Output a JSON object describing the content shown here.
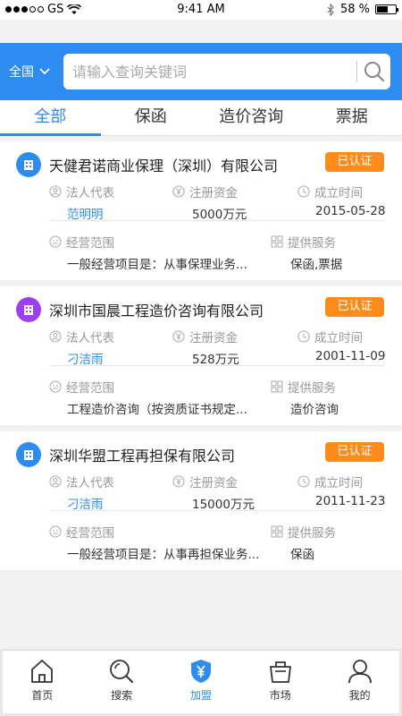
{
  "status_bar": {
    "carrier": "GS",
    "time": "9:41 AM",
    "battery": "58 %",
    "battery_level": 0.58
  },
  "header": {
    "region": "全国",
    "search_placeholder": "请输入查询关键词"
  },
  "tabs": [
    {
      "label": "全部",
      "active": true
    },
    {
      "label": "保函",
      "active": false
    },
    {
      "label": "造价咨询",
      "active": false
    },
    {
      "label": "票据",
      "active": false
    }
  ],
  "field_labels": {
    "legal_rep": "法人代表",
    "capital": "注册资金",
    "founded": "成立时间",
    "scope": "经营范围",
    "services": "提供服务"
  },
  "companies": [
    {
      "name": "天健君诺商业保理（深圳）有限公司",
      "badge": "已认证",
      "icon_color": "#2e8cf0",
      "legal_rep": "范明明",
      "capital": "5000万元",
      "founded": "2015-05-28",
      "scope": "一般经营项目是：从事保理业务...",
      "services": "保函,票据"
    },
    {
      "name": "深圳市国晨工程造价咨询有限公司",
      "badge": "已认证",
      "icon_color": "#9b3ff0",
      "legal_rep": "刁洁雨",
      "capital": "528万元",
      "founded": "2001-11-09",
      "scope": "工程造价咨询（按资质证书规定...",
      "services": "造价咨询"
    },
    {
      "name": "深圳华盟工程再担保有限公司",
      "badge": "已认证",
      "icon_color": "#2e8cf0",
      "legal_rep": "刁洁雨",
      "capital": "15000万元",
      "founded": "2011-11-23",
      "scope": "一般经营项目是：从事再担保业务...",
      "services": "保函"
    }
  ],
  "bottom_nav": [
    {
      "label": "首页",
      "icon": "home-icon",
      "active": false
    },
    {
      "label": "搜索",
      "icon": "search-icon",
      "active": false
    },
    {
      "label": "加盟",
      "icon": "yen-shield-icon",
      "active": true
    },
    {
      "label": "市场",
      "icon": "shop-bag-icon",
      "active": false
    },
    {
      "label": "我的",
      "icon": "user-icon",
      "active": false
    }
  ],
  "colors": {
    "primary": "#2e8cf0",
    "badge": "#ff8c1a",
    "purple": "#9b3ff0"
  }
}
